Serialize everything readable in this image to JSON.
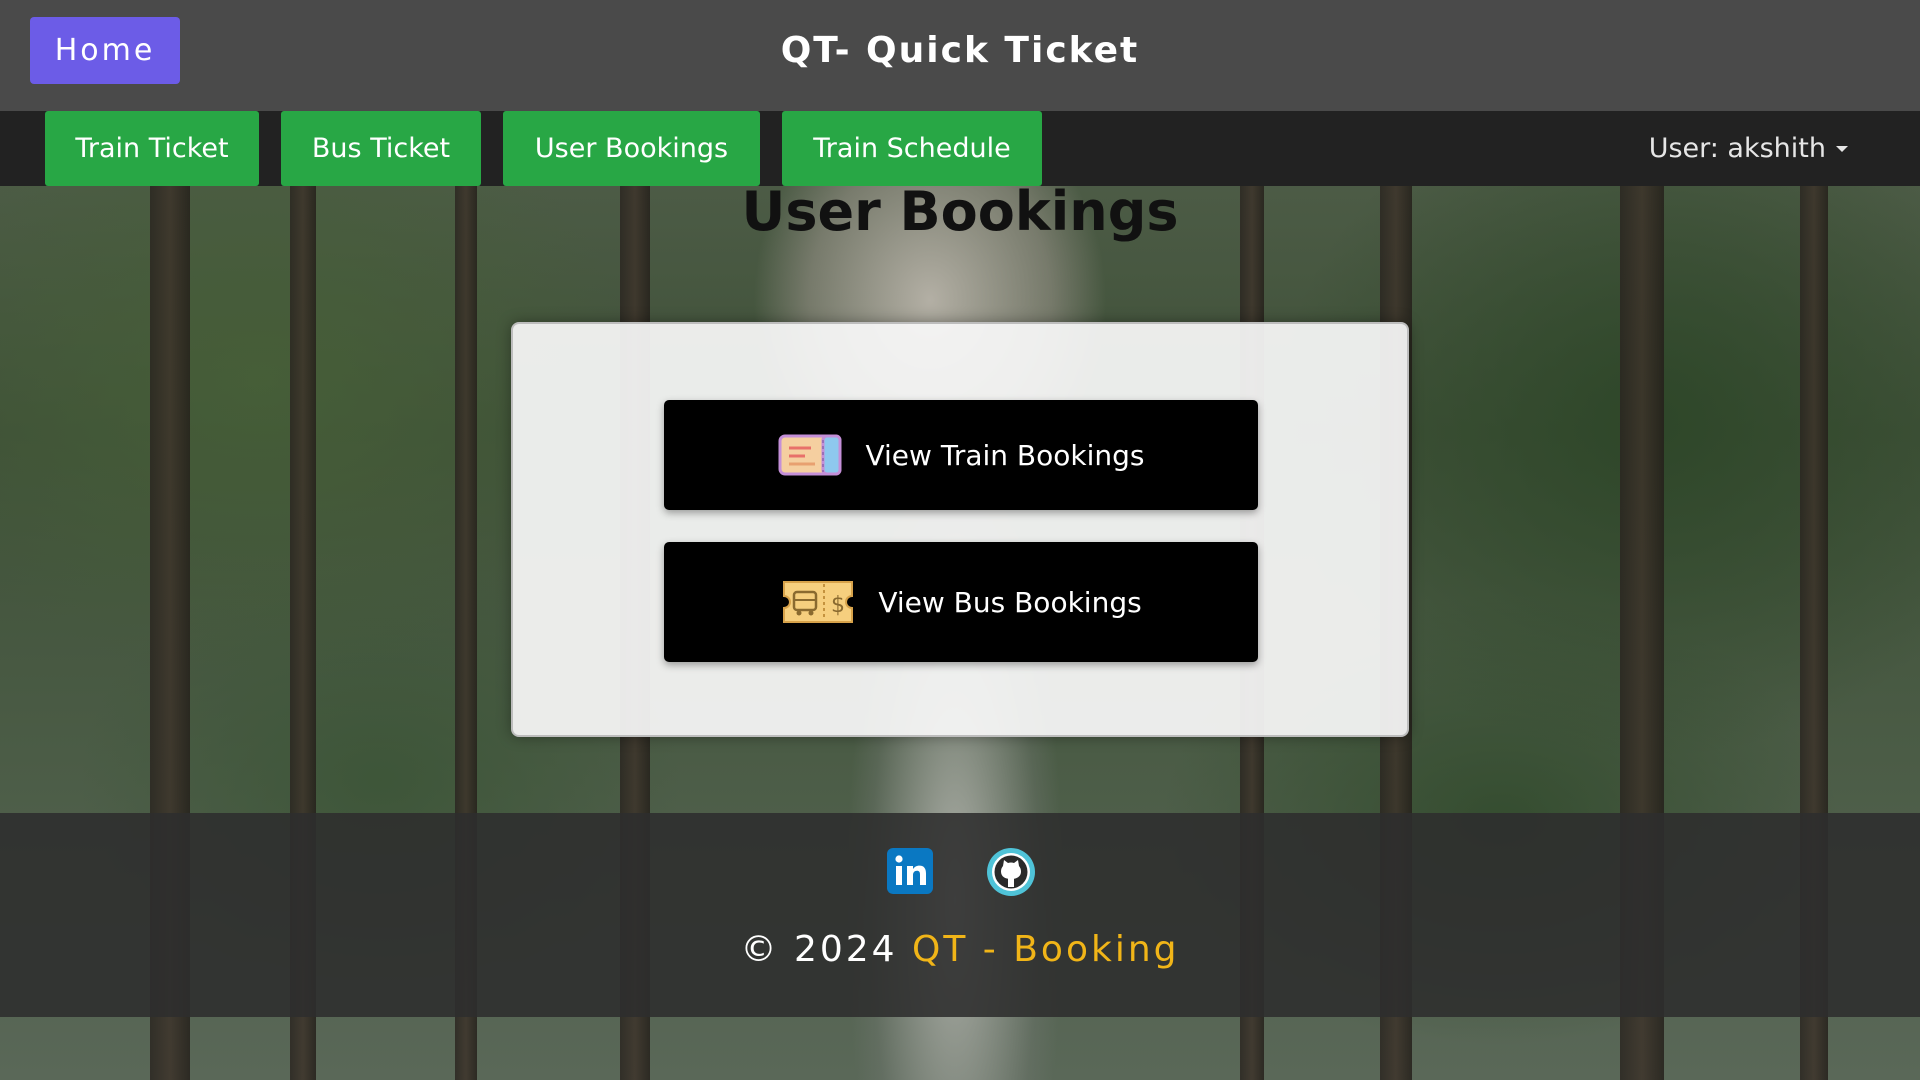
{
  "header": {
    "home_label": "Home",
    "app_title": "QT- Quick Ticket"
  },
  "nav": {
    "items": [
      {
        "label": "Train Ticket"
      },
      {
        "label": "Bus Ticket"
      },
      {
        "label": "User Bookings"
      },
      {
        "label": "Train Schedule"
      }
    ],
    "user_label": "User: akshith"
  },
  "main": {
    "heading": "User Bookings",
    "train_button": {
      "label": "View Train Bookings",
      "icon": "train-ticket-icon"
    },
    "bus_button": {
      "label": "View Bus Bookings",
      "icon": "bus-ticket-icon"
    }
  },
  "footer": {
    "social_icons": [
      "linkedin-icon",
      "github-icon"
    ],
    "copyright_prefix": "© 2024",
    "brand": "QT - Booking"
  },
  "colors": {
    "home_button": "#6c5ce7",
    "nav_button": "#28a745",
    "brand_accent": "#f1b518"
  }
}
